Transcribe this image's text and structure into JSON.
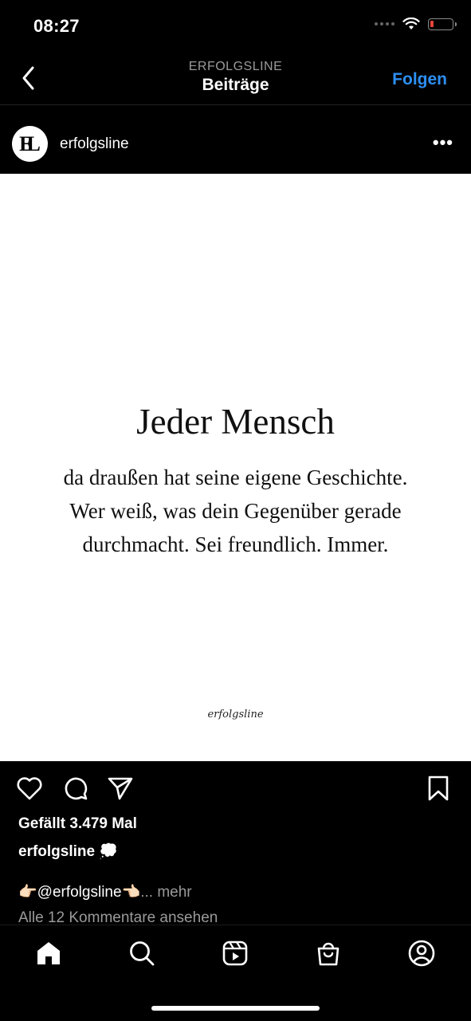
{
  "status_bar": {
    "time": "08:27",
    "battery_level": 0.15,
    "battery_color": "#e8443a"
  },
  "header": {
    "subtitle": "ERFOLGSLINE",
    "title": "Beiträge",
    "follow_label": "Folgen",
    "accent_color": "#2d8ff3"
  },
  "post": {
    "username": "erfolgsline",
    "avatar_icon": "erfolgsline-logo-icon",
    "image": {
      "title": "Jeder Mensch",
      "lines": [
        "da draußen hat seine eigene Geschichte.",
        "Wer weiß, was dein Gegenüber gerade",
        "durchmacht. Sei freundlich. Immer."
      ],
      "watermark": "erfolgsline"
    },
    "likes": "Gefällt 3.479 Mal",
    "caption_user": "erfolgsline",
    "caption_emoji": "💭",
    "caption_text": "👉🏻@erfolgsline👈🏻",
    "caption_more": "... mehr",
    "comments_link": "Alle 12 Kommentare ansehen"
  },
  "actions": [
    "heart-icon",
    "comment-icon",
    "share-icon",
    "bookmark-icon"
  ],
  "tabbar": [
    "home-icon",
    "search-icon",
    "reels-icon",
    "shop-icon",
    "profile-icon"
  ]
}
